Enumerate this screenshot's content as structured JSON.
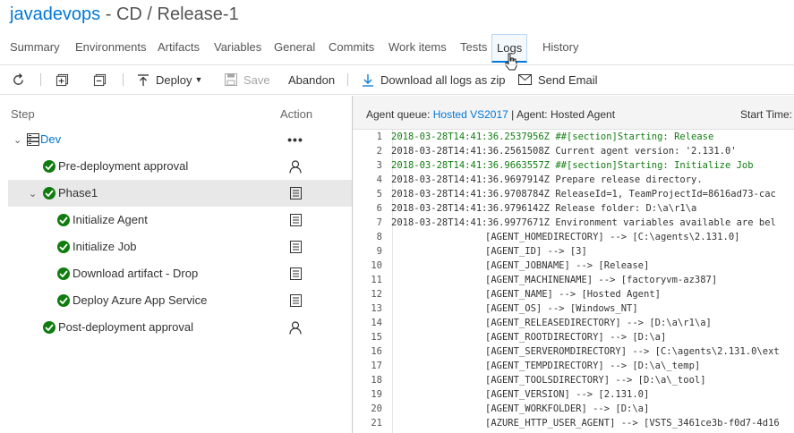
{
  "header": {
    "project": "javadevops",
    "separator": " - CD / ",
    "release": "Release-1"
  },
  "tabs": [
    {
      "label": "Summary"
    },
    {
      "label": "Environments"
    },
    {
      "label": "Artifacts"
    },
    {
      "label": "Variables"
    },
    {
      "label": "General"
    },
    {
      "label": "Commits"
    },
    {
      "label": "Work items"
    },
    {
      "label": "Tests"
    },
    {
      "label": "Logs",
      "active": true
    },
    {
      "label": "History"
    }
  ],
  "toolbar": {
    "deploy_label": "Deploy",
    "save_label": "Save",
    "abandon_label": "Abandon",
    "download_label": "Download all logs as zip",
    "email_label": "Send Email"
  },
  "tree": {
    "step_header": "Step",
    "action_header": "Action",
    "items": [
      {
        "label": "Dev",
        "level": 0,
        "icon": "environment-icon",
        "action": "more-icon"
      },
      {
        "label": "Pre-deployment approval",
        "level": 1,
        "status": "succeeded",
        "action": "person-icon"
      },
      {
        "label": "Phase1",
        "level": 1,
        "status": "succeeded",
        "action": "log-icon",
        "selected": true
      },
      {
        "label": "Initialize Agent",
        "level": 2,
        "status": "succeeded",
        "action": "log-icon"
      },
      {
        "label": "Initialize Job",
        "level": 2,
        "status": "succeeded",
        "action": "log-icon"
      },
      {
        "label": "Download artifact - Drop",
        "level": 2,
        "status": "succeeded",
        "action": "log-icon"
      },
      {
        "label": "Deploy Azure App Service",
        "level": 2,
        "status": "succeeded",
        "action": "log-icon"
      },
      {
        "label": "Post-deployment approval",
        "level": 1,
        "status": "succeeded",
        "action": "person-icon"
      }
    ]
  },
  "agent": {
    "queue_label": "Agent queue:",
    "queue_value": "Hosted VS2017",
    "agent_label": "| Agent: Hosted Agent",
    "start_label": "Start Time:"
  },
  "colors": {
    "accent": "#0078d7",
    "success": "#107c10"
  },
  "log": {
    "lines": [
      {
        "n": "1",
        "t": "2018-03-28T14:41:36.2537956Z ##[section]Starting: Release",
        "kind": "section"
      },
      {
        "n": "2",
        "t": "2018-03-28T14:41:36.2561508Z Current agent version: '2.131.0'",
        "kind": "normal"
      },
      {
        "n": "3",
        "t": "2018-03-28T14:41:36.9663557Z ##[section]Starting: Initialize Job",
        "kind": "section"
      },
      {
        "n": "4",
        "t": "2018-03-28T14:41:36.9697914Z Prepare release directory.",
        "kind": "normal"
      },
      {
        "n": "5",
        "t": "2018-03-28T14:41:36.9708784Z ReleaseId=1, TeamProjectId=8616ad73-cac",
        "kind": "normal"
      },
      {
        "n": "6",
        "t": "2018-03-28T14:41:36.9796142Z Release folder: D:\\a\\r1\\a",
        "kind": "normal"
      },
      {
        "n": "7",
        "t": "2018-03-28T14:41:36.9977671Z Environment variables available are bel",
        "kind": "normal"
      },
      {
        "n": "8",
        "t": "[AGENT_HOMEDIRECTORY] --> [C:\\agents\\2.131.0]",
        "kind": "indent"
      },
      {
        "n": "9",
        "t": "[AGENT_ID] --> [3]",
        "kind": "indent"
      },
      {
        "n": "10",
        "t": "[AGENT_JOBNAME] --> [Release]",
        "kind": "indent"
      },
      {
        "n": "11",
        "t": "[AGENT_MACHINENAME] --> [factoryvm-az387]",
        "kind": "indent"
      },
      {
        "n": "12",
        "t": "[AGENT_NAME] --> [Hosted Agent]",
        "kind": "indent"
      },
      {
        "n": "13",
        "t": "[AGENT_OS] --> [Windows_NT]",
        "kind": "indent"
      },
      {
        "n": "14",
        "t": "[AGENT_RELEASEDIRECTORY] --> [D:\\a\\r1\\a]",
        "kind": "indent"
      },
      {
        "n": "15",
        "t": "[AGENT_ROOTDIRECTORY] --> [D:\\a]",
        "kind": "indent"
      },
      {
        "n": "16",
        "t": "[AGENT_SERVEROMDIRECTORY] --> [C:\\agents\\2.131.0\\ext",
        "kind": "indent"
      },
      {
        "n": "17",
        "t": "[AGENT_TEMPDIRECTORY] --> [D:\\a\\_temp]",
        "kind": "indent"
      },
      {
        "n": "18",
        "t": "[AGENT_TOOLSDIRECTORY] --> [D:\\a\\_tool]",
        "kind": "indent"
      },
      {
        "n": "19",
        "t": "[AGENT_VERSION] --> [2.131.0]",
        "kind": "indent"
      },
      {
        "n": "20",
        "t": "[AGENT_WORKFOLDER] --> [D:\\a]",
        "kind": "indent"
      },
      {
        "n": "21",
        "t": "[AZURE_HTTP_USER_AGENT] --> [VSTS_3461ce3b-f0d7-4d16",
        "kind": "indent"
      }
    ]
  }
}
